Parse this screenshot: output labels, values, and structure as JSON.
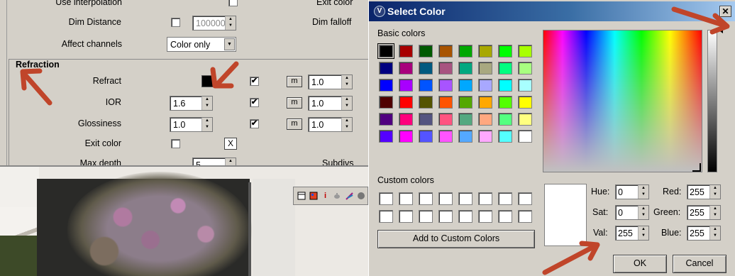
{
  "panel": {
    "use_interpolation_label": "Use interpolation",
    "exit_color_top_label": "Exit color",
    "dim_distance_label": "Dim Distance",
    "dim_distance_value": "100000",
    "dim_falloff_label": "Dim falloff",
    "affect_channels_label": "Affect channels",
    "affect_channels_value": "Color only",
    "refraction_group_title": "Refraction",
    "refract_label": "Refract",
    "refract_checked": "✔",
    "refract_m": "m",
    "refract_amount": "1.0",
    "ior_label": "IOR",
    "ior_value": "1.6",
    "ior_checked": "✔",
    "ior_m": "m",
    "ior_amount": "1.0",
    "glossiness_label": "Glossiness",
    "glossiness_value": "1.0",
    "glossiness_checked": "✔",
    "glossiness_m": "m",
    "glossiness_amount": "1.0",
    "exit_color_label": "Exit color",
    "exit_color_x": "X",
    "max_depth_label": "Max depth",
    "max_depth_value": "5",
    "subdivs_label": "Subdivs"
  },
  "viewport_toolbar": {
    "icons": [
      "layout-icon",
      "material-icon",
      "info-icon",
      "teapot-icon",
      "brush-icon",
      "sphere-icon"
    ],
    "info_glyph": "i"
  },
  "dialog": {
    "title": "Select Color",
    "close_glyph": "✕",
    "basic_colors_label": "Basic colors",
    "basic_colors": [
      "#000000",
      "#a80000",
      "#005a00",
      "#a85400",
      "#00a800",
      "#a8a800",
      "#00ff00",
      "#a8ff00",
      "#000080",
      "#a8007c",
      "#005a80",
      "#a85480",
      "#00a880",
      "#a8a880",
      "#00ff80",
      "#a8ff80",
      "#0000ff",
      "#a800ff",
      "#0054ff",
      "#a854ff",
      "#00a8ff",
      "#a8a8ff",
      "#00ffff",
      "#a8ffff",
      "#500000",
      "#ff0000",
      "#545400",
      "#ff5400",
      "#54a800",
      "#ffa800",
      "#54ff00",
      "#ffff00",
      "#500080",
      "#ff007c",
      "#545480",
      "#ff5480",
      "#54a880",
      "#ffa880",
      "#54ff80",
      "#ffff80",
      "#5400ff",
      "#ff00ff",
      "#5454ff",
      "#ff54ff",
      "#54a8ff",
      "#ffa8ff",
      "#54ffff",
      "#ffffff"
    ],
    "custom_colors_label": "Custom colors",
    "add_custom_label": "Add to Custom Colors",
    "hue_label": "Hue:",
    "hue_value": "0",
    "sat_label": "Sat:",
    "sat_value": "0",
    "val_label": "Val:",
    "val_value": "255",
    "red_label": "Red:",
    "red_value": "255",
    "green_label": "Green:",
    "green_value": "255",
    "blue_label": "Blue:",
    "blue_value": "255",
    "ok_label": "OK",
    "cancel_label": "Cancel",
    "current_color": "#ffffff"
  },
  "colors": {
    "annotation_arrow": "#c0452a",
    "titlebar_start": "#0a246a",
    "titlebar_end": "#a6caf0",
    "dialog_background": "#d4d0c8"
  }
}
